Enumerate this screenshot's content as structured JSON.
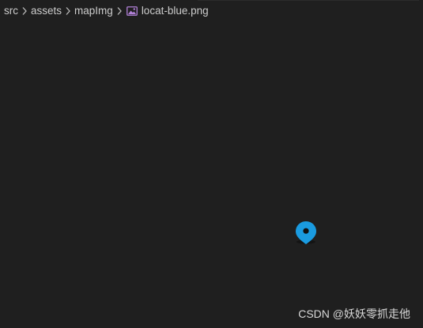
{
  "breadcrumb": {
    "items": [
      "src",
      "assets",
      "mapImg"
    ],
    "file": "locat-blue.png",
    "separator_icon": "chevron-right-icon",
    "file_icon": "image-file-icon"
  },
  "preview": {
    "icon": "location-pin-icon",
    "pin_color": "#1a9be0"
  },
  "watermark": {
    "text": "CSDN @妖妖零抓走他"
  },
  "colors": {
    "background": "#1f1f1f",
    "text": "#cccccc",
    "file_icon_accent": "#b180d7"
  }
}
